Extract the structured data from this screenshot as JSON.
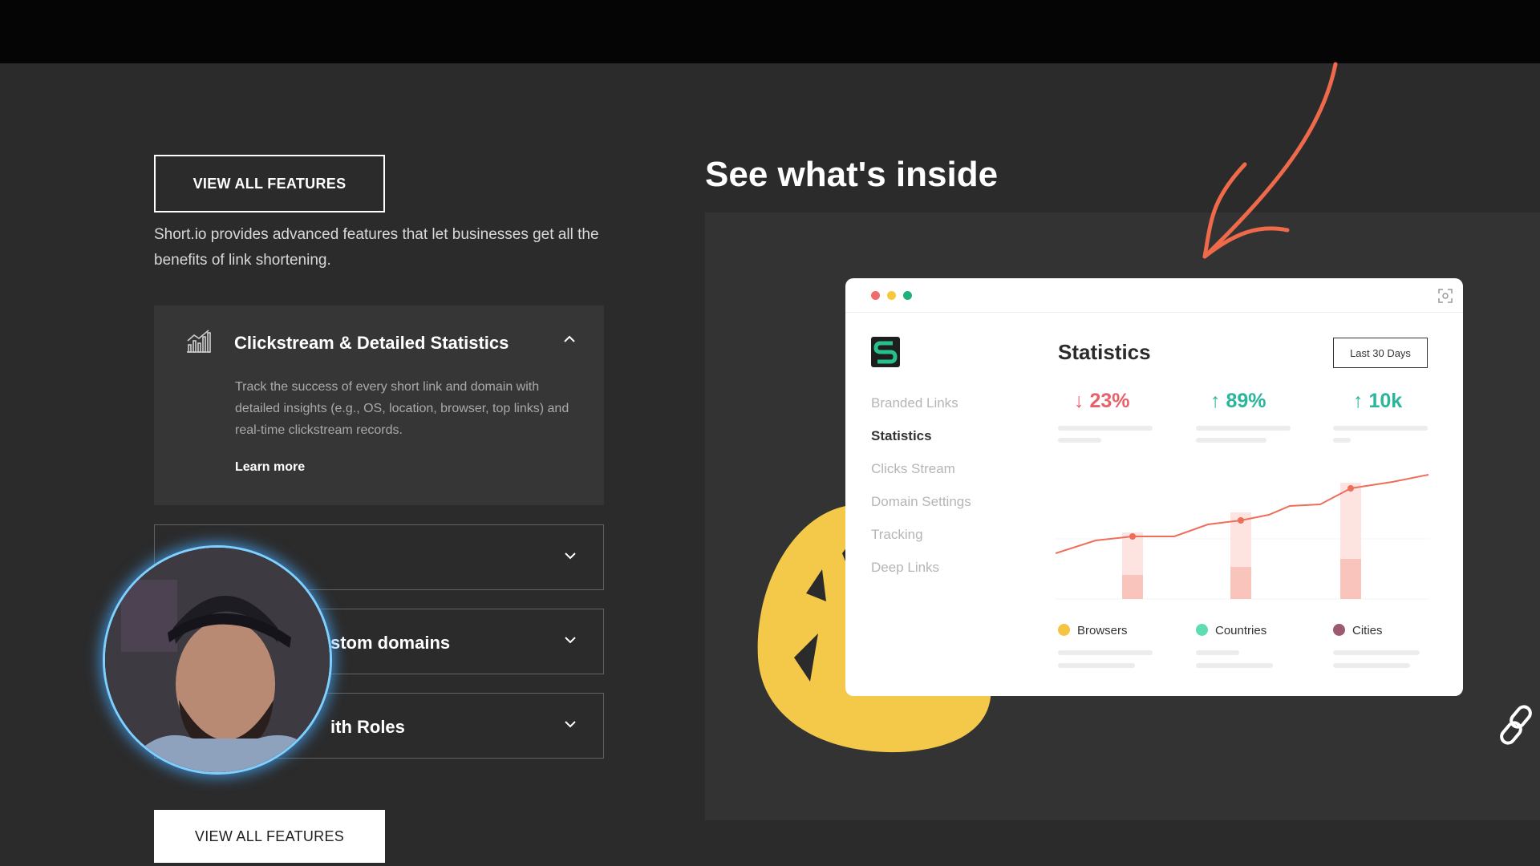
{
  "features": {
    "view_all_top": "VIEW ALL FEATURES",
    "intro": "Short.io provides advanced features that let businesses get all the benefits of link shortening.",
    "open_item": {
      "title": "Clickstream & Detailed Statistics",
      "description": "Track the success of every short link and domain with detailed insights (e.g., OS, location, browser, top links) and real-time clickstream records.",
      "learn_more": "Learn more",
      "icon": "bar-chart-icon"
    },
    "collapsed_items": [
      {
        "title": ""
      },
      {
        "title": "stom domains"
      },
      {
        "title": "ith Roles"
      }
    ],
    "view_all_bottom": "VIEW ALL FEATURES"
  },
  "preview": {
    "heading": "See what's inside",
    "app": {
      "window_dots": [
        "#f06b6b",
        "#f5c93b",
        "#22b07a"
      ],
      "title": "Statistics",
      "range_button": "Last 30 Days",
      "sidebar": [
        {
          "label": "Branded Links",
          "active": false
        },
        {
          "label": "Statistics",
          "active": true
        },
        {
          "label": "Clicks Stream",
          "active": false
        },
        {
          "label": "Domain Settings",
          "active": false
        },
        {
          "label": "Tracking",
          "active": false
        },
        {
          "label": "Deep Links",
          "active": false
        }
      ],
      "stats": [
        {
          "arrow": "↓",
          "value": "23%",
          "trend": "down"
        },
        {
          "arrow": "↑",
          "value": "89%",
          "trend": "up"
        },
        {
          "arrow": "↑",
          "value": "10k",
          "trend": "up"
        }
      ],
      "legend": [
        {
          "label": "Browsers",
          "color": "#f5c443"
        },
        {
          "label": "Countries",
          "color": "#5fdcb0"
        },
        {
          "label": "Cities",
          "color": "#9b5a72"
        }
      ]
    }
  },
  "colors": {
    "accent_arrow": "#ef6a4a",
    "scribble": "#f4c94a",
    "chart_line": "#ee6e5a"
  }
}
